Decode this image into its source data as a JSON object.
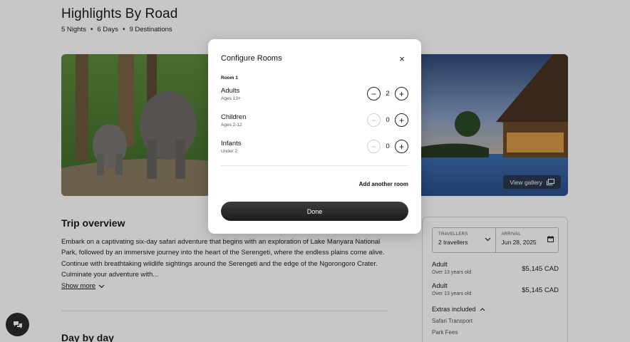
{
  "page": {
    "title": "Highlights By Road",
    "meta": [
      "5 Nights",
      "6 Days",
      "9 Destinations"
    ],
    "meta_separator": "•",
    "gallery_label": "View gallery",
    "overview_title": "Trip overview",
    "overview_text": "Embark on a captivating six-day safari adventure that begins with an exploration of Lake Manyara National Park, followed by an immersive journey into the heart of the Serengeti, where the endless plains come alive. Continue with breathtaking wildlife sightings around the Serengeti and the edge of the Ngorongoro Crater. Culminate your adventure with...",
    "show_more": "Show more",
    "day_by_day_title": "Day by day"
  },
  "booking": {
    "travellers_label": "TRAVELLERS",
    "travellers_value": "2 travellers",
    "arrival_label": "ARRIVAL",
    "arrival_value": "Jun 28, 2025",
    "prices": [
      {
        "label": "Adult",
        "sub": "Over 13 years old",
        "amount": "$5,145 CAD"
      },
      {
        "label": "Adult",
        "sub": "Over 13 years old",
        "amount": "$5,145 CAD"
      }
    ],
    "extras_label": "Extras included",
    "extras": [
      "Safari Transport",
      "Park Fees"
    ]
  },
  "modal": {
    "title": "Configure Rooms",
    "close_icon": "×",
    "room_label": "Room 1",
    "guests": [
      {
        "name": "Adults",
        "sub": "Ages 13+",
        "count": "2",
        "minus_enabled": true
      },
      {
        "name": "Children",
        "sub": "Ages 2-12",
        "count": "0",
        "minus_enabled": false
      },
      {
        "name": "Infants",
        "sub": "Under 2",
        "count": "0",
        "minus_enabled": false
      }
    ],
    "minus_symbol": "−",
    "plus_symbol": "+",
    "add_room": "Add another room",
    "done": "Done"
  },
  "colors": {
    "overlay": "rgba(0,0,0,0.22)",
    "done_button": "#262626"
  }
}
